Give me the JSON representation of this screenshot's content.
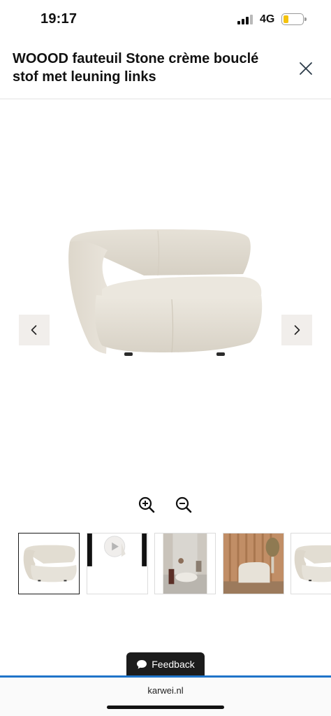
{
  "status_bar": {
    "time": "19:17",
    "network": "4G",
    "signal_bars_filled": 3,
    "signal_bars_total": 4,
    "battery_level": 0.25,
    "battery_color": "#f4c20d"
  },
  "header": {
    "title": "WOOOD fauteuil Stone crème bouclé stof met leuning links",
    "close_icon": "close-icon"
  },
  "gallery": {
    "prev_icon": "chevron-left-icon",
    "next_icon": "chevron-right-icon",
    "zoom_in_icon": "zoom-in-icon",
    "zoom_out_icon": "zoom-out-icon",
    "nav_button_color": "#f1eeeb",
    "thumbnails": [
      {
        "kind": "image",
        "subject": "armchair",
        "active": true
      },
      {
        "kind": "video",
        "subject": "play-icon",
        "active": false
      },
      {
        "kind": "image",
        "subject": "living-room",
        "active": false
      },
      {
        "kind": "image",
        "subject": "wood-wall-room",
        "active": false
      },
      {
        "kind": "image",
        "subject": "armchair",
        "active": false
      }
    ]
  },
  "feedback": {
    "label": "Feedback",
    "icon": "speech-bubble-icon"
  },
  "browser": {
    "url": "karwei.nl",
    "accent_color": "#1f74c9"
  }
}
